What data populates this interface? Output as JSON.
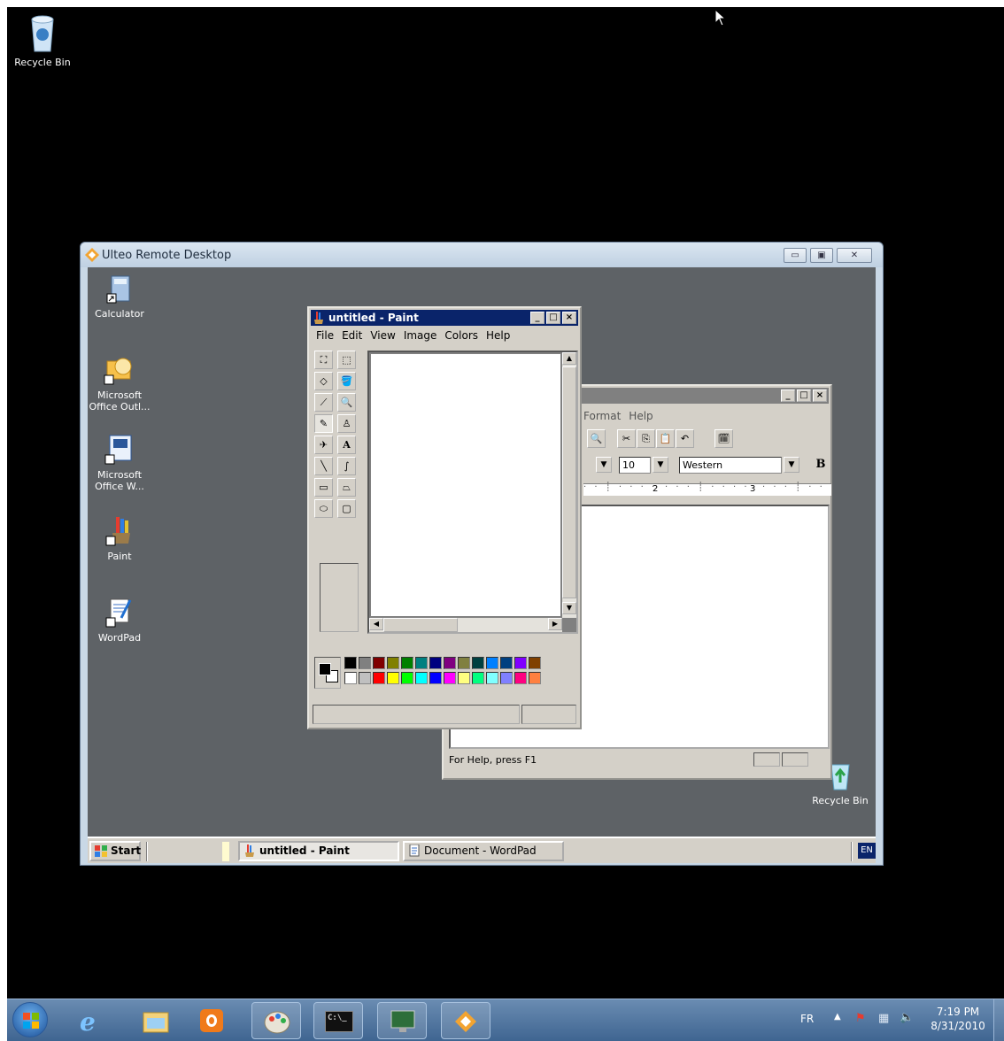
{
  "desktop": {
    "recycle_bin_label": "Recycle Bin"
  },
  "remote": {
    "title": "Ulteo Remote Desktop",
    "desktop_icons": [
      {
        "name": "Calculator"
      },
      {
        "name": "Microsoft\nOffice Outl..."
      },
      {
        "name": "Microsoft\nOffice W..."
      },
      {
        "name": "Paint"
      },
      {
        "name": "WordPad"
      }
    ],
    "recycle_bin_label": "Recycle Bin"
  },
  "paint": {
    "title": "untitled - Paint",
    "menu": [
      "File",
      "Edit",
      "View",
      "Image",
      "Colors",
      "Help"
    ],
    "palette_top": [
      "#000000",
      "#808080",
      "#800000",
      "#808000",
      "#008000",
      "#008080",
      "#000080",
      "#800080",
      "#808040",
      "#004040",
      "#0080ff",
      "#004080",
      "#8000ff",
      "#804000"
    ],
    "palette_bottom": [
      "#ffffff",
      "#c0c0c0",
      "#ff0000",
      "#ffff00",
      "#00ff00",
      "#00ffff",
      "#0000ff",
      "#ff00ff",
      "#ffff80",
      "#00ff80",
      "#80ffff",
      "#8080ff",
      "#ff0080",
      "#ff8040"
    ]
  },
  "wordpad": {
    "menu": [
      "Format",
      "Help"
    ],
    "font_size": "10",
    "script": "Western",
    "bold": "B",
    "ruler_marks": [
      "2",
      "3"
    ],
    "status": "For Help, press F1"
  },
  "remote_taskbar": {
    "start": "Start",
    "paint_task": "untitled - Paint",
    "wordpad_task": "Document - WordPad",
    "lang": "EN"
  },
  "win7_taskbar": {
    "lang": "FR",
    "time": "7:19 PM",
    "date": "8/31/2010"
  }
}
